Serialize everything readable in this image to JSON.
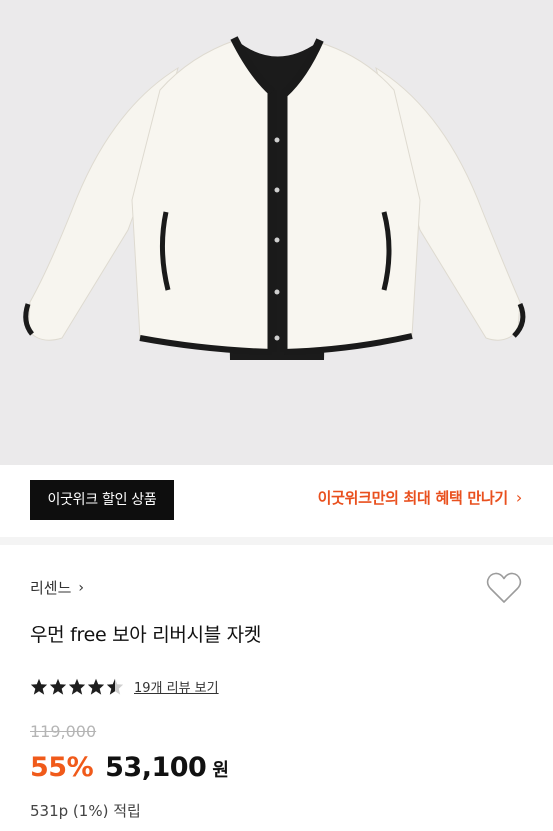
{
  "product_image": {
    "alt": ""
  },
  "promo": {
    "badge_label": "이굿위크 할인 상품",
    "link_label": "이굿위크만의 최대 혜택 만나기",
    "link_chevron": "›"
  },
  "product": {
    "brand": "리센느",
    "brand_chevron": "›",
    "title": "우먼 free 보아 리버시블 자켓",
    "rating": 4.5,
    "review_link": "19개 리뷰 보기",
    "original_price": "119,000",
    "discount": "55%",
    "price": "53,100",
    "currency": "원",
    "points": "531p (1%) 적립"
  },
  "icons": {
    "wishlist": "heart-outline-icon",
    "star": "star-icon"
  },
  "colors": {
    "accent": "#e9501e",
    "discount": "#f05a1a",
    "badge_bg": "#0e0e0e"
  }
}
